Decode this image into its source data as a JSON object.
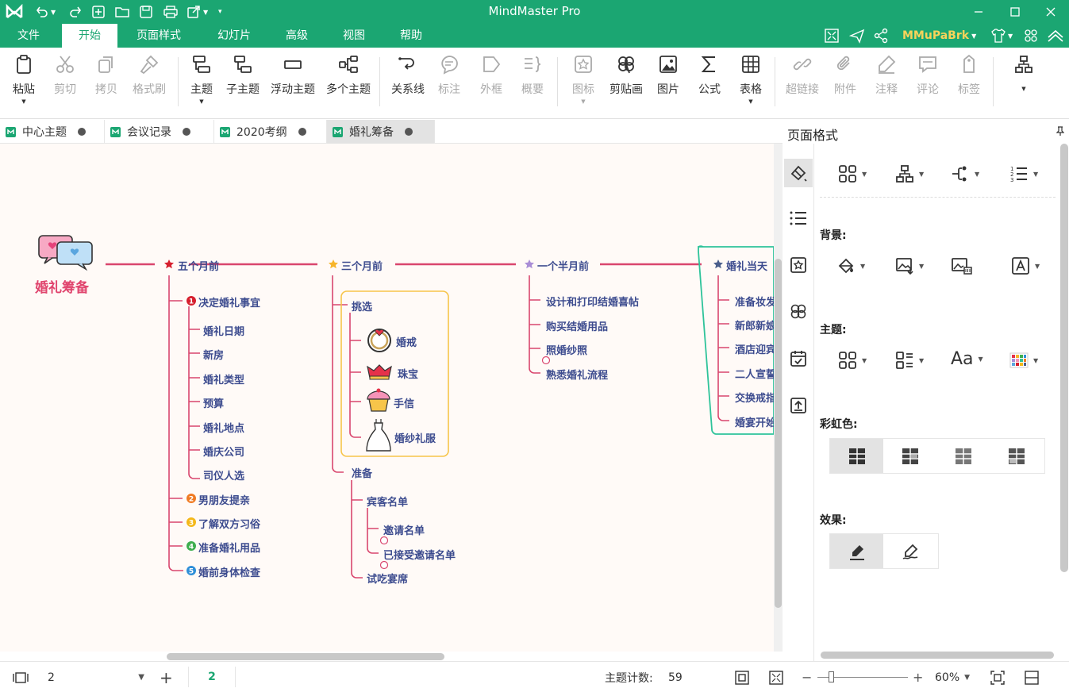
{
  "app": {
    "title": "MindMaster Pro",
    "user": "MMuPaBrk"
  },
  "menu": [
    "文件",
    "开始",
    "页面样式",
    "幻灯片",
    "高级",
    "视图",
    "帮助"
  ],
  "ribbon": {
    "paste": "粘贴",
    "cut": "剪切",
    "copy": "拷贝",
    "format_painter": "格式刷",
    "topic": "主题",
    "subtopic": "子主题",
    "floating_topic": "浮动主题",
    "multiple_topics": "多个主题",
    "relationship": "关系线",
    "callout": "标注",
    "boundary": "外框",
    "summary": "概要",
    "icon": "图标",
    "clipart": "剪贴画",
    "image": "图片",
    "formula": "公式",
    "table": "表格",
    "hyperlink": "超链接",
    "attachment": "附件",
    "note": "注释",
    "comment": "评论",
    "tag": "标签"
  },
  "tabs": [
    "中心主题",
    "会议记录",
    "2020考纲",
    "婚礼筹备"
  ],
  "panel": {
    "title": "页面格式",
    "background_label": "背景:",
    "theme_label": "主题:",
    "rainbow_label": "彩虹色:",
    "effect_label": "效果:"
  },
  "mindmap": {
    "central": "婚礼筹备",
    "branches": [
      {
        "label": "五个月前",
        "children": [
          "决定婚礼事宜",
          "男朋友提亲",
          "了解双方习俗",
          "准备婚礼用品",
          "婚前身体检查"
        ],
        "sub": [
          "婚礼日期",
          "新房",
          "婚礼类型",
          "预算",
          "婚礼地点",
          "婚庆公司",
          "司仪人选"
        ]
      },
      {
        "label": "三个月前",
        "children": [
          "挑选",
          "准备"
        ],
        "pick": [
          "婚戒",
          "珠宝",
          "手信",
          "婚纱礼服"
        ],
        "prep": [
          "宾客名单",
          "试吃宴席"
        ],
        "guest": [
          "邀请名单",
          "已接受邀请名单"
        ]
      },
      {
        "label": "一个半月前",
        "children": [
          "设计和打印结婚喜帖",
          "购买结婚用品",
          "照婚纱照",
          "熟悉婚礼流程"
        ]
      },
      {
        "label": "婚礼当天",
        "children": [
          "准备妆发",
          "新郎新娘",
          "酒店迎宾",
          "二人宣誓",
          "交换戒指",
          "婚宴开始"
        ]
      }
    ]
  },
  "status": {
    "page_value": "2",
    "page_num": "2",
    "topic_count_label": "主题计数:",
    "topic_count": "59",
    "zoom": "60%"
  }
}
